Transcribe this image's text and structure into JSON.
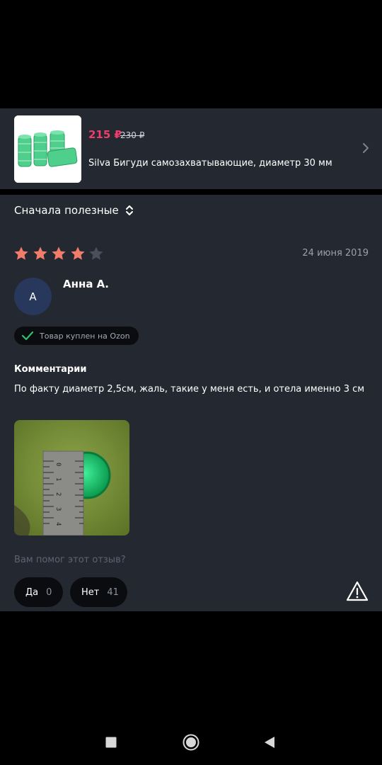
{
  "product": {
    "price": "215 ₽",
    "old_price": "230 ₽",
    "title": "Silva Бигуди самозахватывающие, диаметр 30 мм",
    "thumbnail_icon": "hair-rollers-image"
  },
  "sort": {
    "label": "Сначала полезные",
    "icon": "sort-updown-icon"
  },
  "review": {
    "rating": 4,
    "max_rating": 5,
    "date": "24 июня 2019",
    "author": "Анна А.",
    "avatar_letter": "А",
    "verified_badge": "Товар куплен на Ozon",
    "comments_title": "Комментарии",
    "comment": "По факту диаметр 2,5см, жаль, такие у меня есть, и отела именно 3 см",
    "photo_icon": "ruler-and-roller-photo",
    "ruler_numbers": [
      "0",
      "1",
      "2",
      "3",
      "4"
    ]
  },
  "feedback": {
    "question": "Вам помог этот отзыв?",
    "yes_label": "Да",
    "yes_count": "0",
    "no_label": "Нет",
    "no_count": "41",
    "report_icon": "warning-triangle-icon"
  },
  "colors": {
    "panel_bg": "#242830",
    "price": "#f23c6a",
    "star_filled": "#f27c6a",
    "star_empty": "#4a505b",
    "avatar_bg": "#27385c",
    "check": "#2fc26a",
    "pill_bg": "#0a0c10"
  }
}
